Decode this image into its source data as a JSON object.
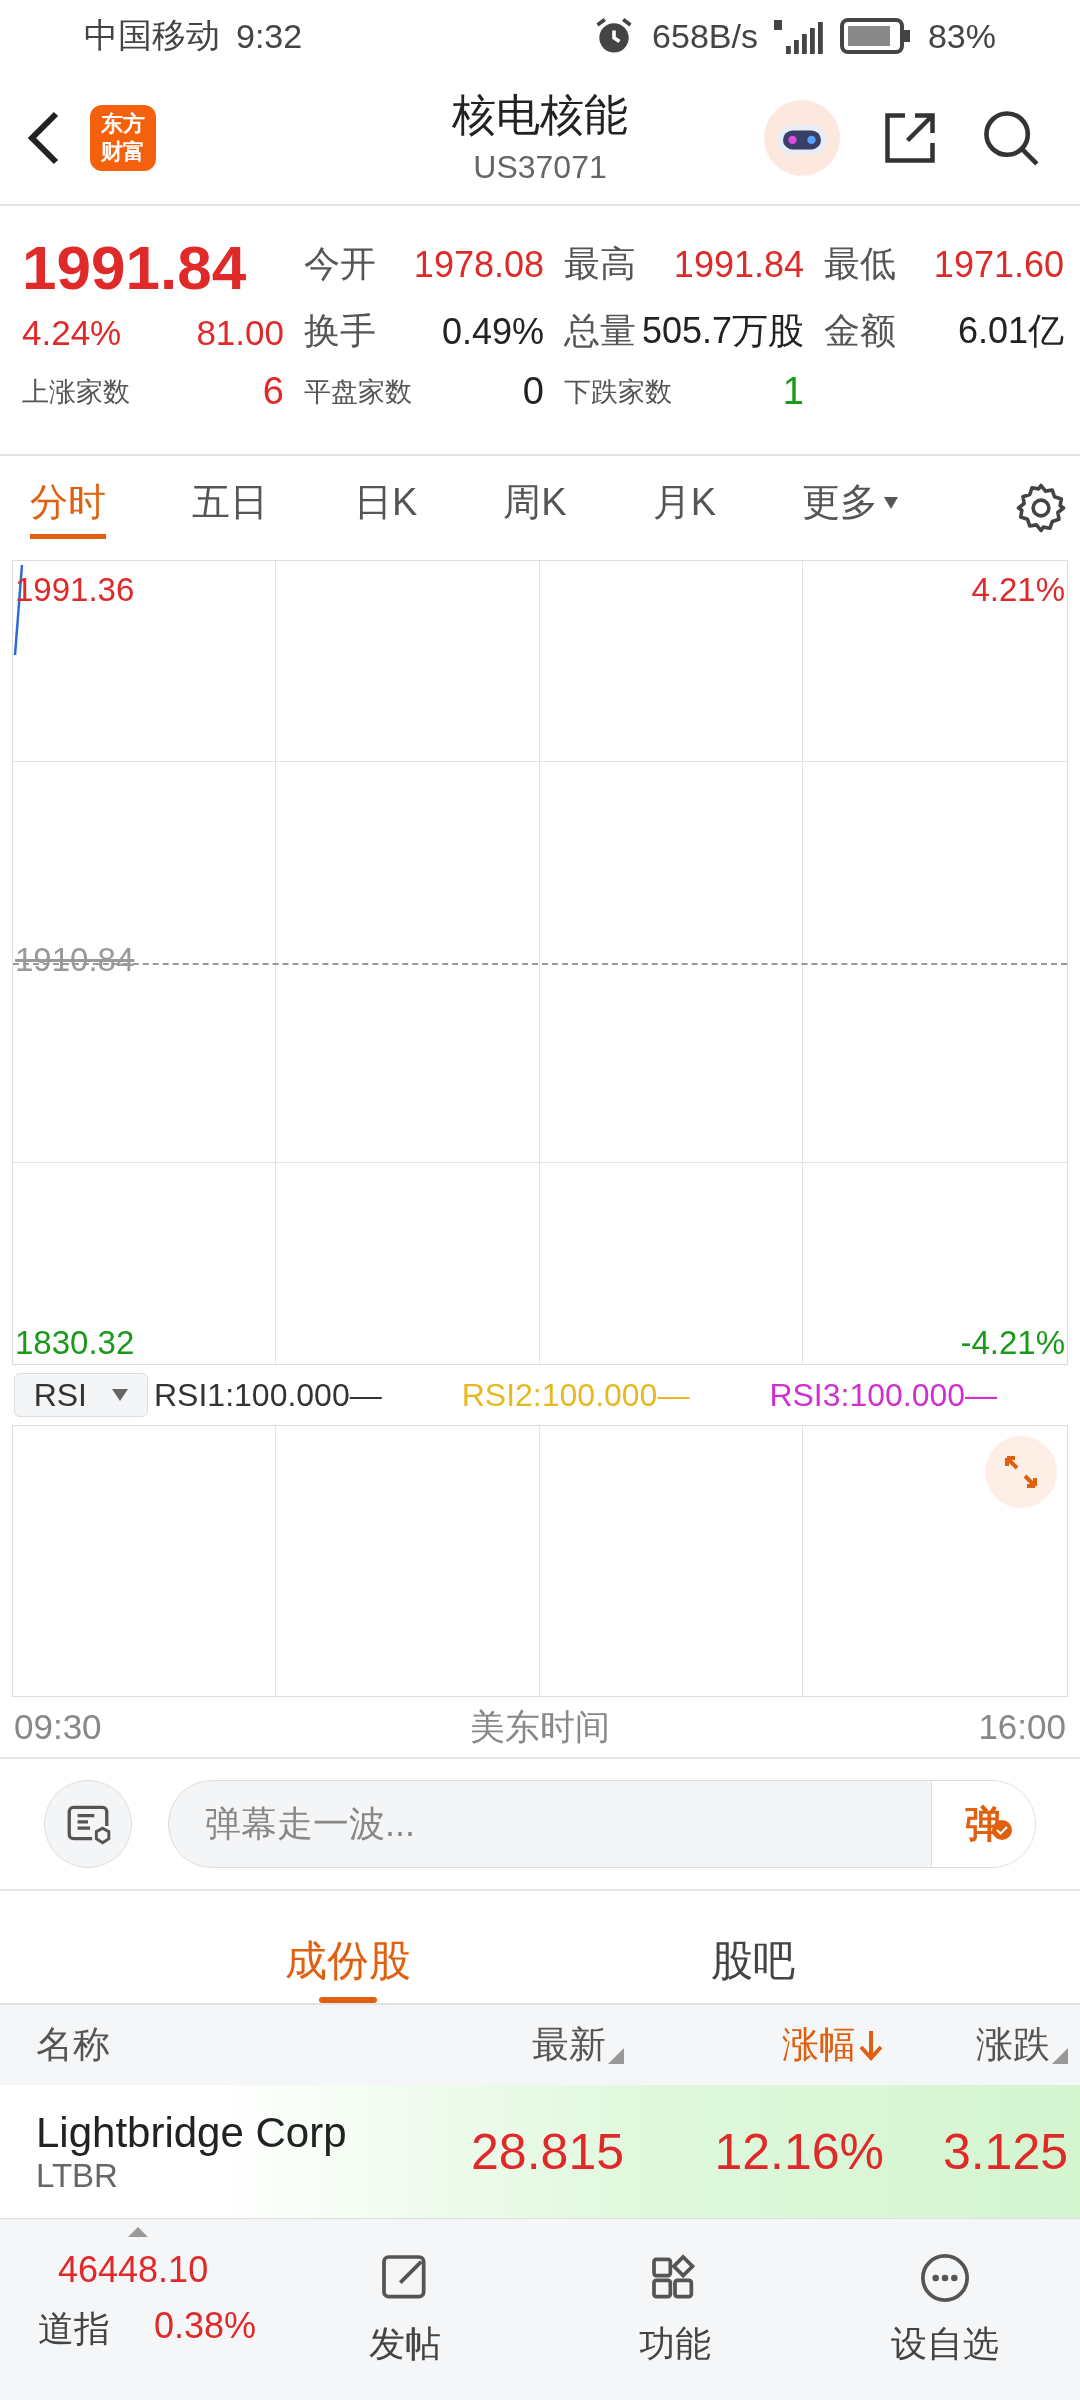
{
  "status_bar": {
    "carrier": "中国移动",
    "time": "9:32",
    "speed": "658B/s",
    "battery": "83%"
  },
  "header": {
    "title": "核电核能",
    "code": "US37071",
    "logo_lines": [
      "东方",
      "财富"
    ]
  },
  "quote": {
    "price": "1991.84",
    "change_pct": "4.24%",
    "change": "81.00",
    "stats": [
      {
        "label": "今开",
        "value": "1978.08",
        "color": "#e02a2a"
      },
      {
        "label": "最高",
        "value": "1991.84",
        "color": "#e02a2a"
      },
      {
        "label": "最低",
        "value": "1971.60",
        "color": "#e02a2a"
      },
      {
        "label": "换手",
        "value": "0.49%",
        "color": "#222222"
      },
      {
        "label": "总量",
        "value": "505.7万股",
        "color": "#222222"
      },
      {
        "label": "金额",
        "value": "6.01亿",
        "color": "#222222"
      }
    ],
    "breadth": [
      {
        "label": "上涨家数",
        "value": "6",
        "color": "#e02a2a"
      },
      {
        "label": "平盘家数",
        "value": "0",
        "color": "#222222"
      },
      {
        "label": "下跌家数",
        "value": "1",
        "color": "#1a9a1a"
      }
    ]
  },
  "chart_tabs": [
    {
      "label": "分时",
      "selected": true
    },
    {
      "label": "五日",
      "selected": false
    },
    {
      "label": "日K",
      "selected": false
    },
    {
      "label": "周K",
      "selected": false
    },
    {
      "label": "月K",
      "selected": false
    },
    {
      "label": "更多",
      "selected": false
    }
  ],
  "chart": {
    "high": "1991.36",
    "mid": "1910.84",
    "low": "1830.32",
    "high_pct": "4.21%",
    "low_pct": "-4.21%"
  },
  "indicator": {
    "select": "RSI",
    "lines": [
      {
        "text": "RSI1:100.000—",
        "color": "#333333"
      },
      {
        "text": "RSI2:100.000—",
        "color": "#e8b820"
      },
      {
        "text": "RSI3:100.000—",
        "color": "#d030d0"
      }
    ]
  },
  "time_axis": {
    "start": "09:30",
    "label": "美东时间",
    "end": "16:00"
  },
  "danmaku": {
    "placeholder": "弹幕走一波...",
    "send": "弹"
  },
  "list_tabs": [
    {
      "label": "成份股",
      "selected": true
    },
    {
      "label": "股吧",
      "selected": false
    }
  ],
  "table": {
    "columns": [
      {
        "label": "名称",
        "kind": "plain"
      },
      {
        "label": "最新",
        "kind": "sortable"
      },
      {
        "label": "涨幅",
        "kind": "sorted"
      },
      {
        "label": "涨跌",
        "kind": "sortable"
      }
    ],
    "rows": [
      {
        "name": "Lightbridge Corp",
        "code": "LTBR",
        "latest": "28.815",
        "pct": "12.16%",
        "change": "3.125"
      }
    ]
  },
  "bottom_bar": {
    "index": {
      "value": "46448.10",
      "name": "道指",
      "pct": "0.38%"
    },
    "items": [
      {
        "kind": "post",
        "label": "发帖"
      },
      {
        "kind": "grid",
        "label": "功能"
      },
      {
        "kind": "more",
        "label": "设自选"
      }
    ]
  }
}
